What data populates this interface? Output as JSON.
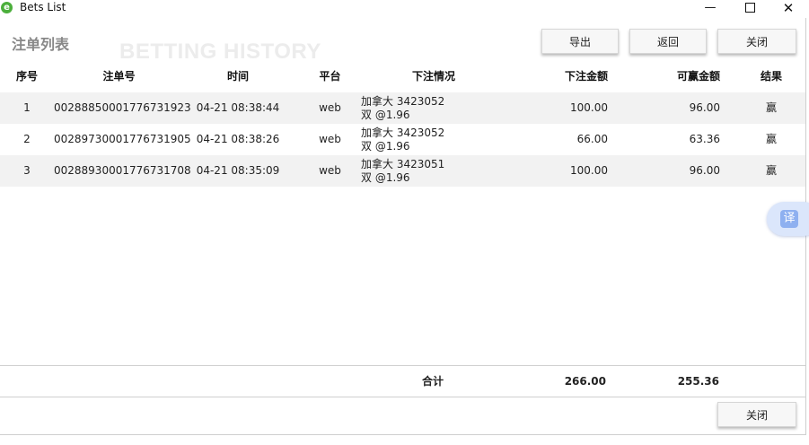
{
  "window": {
    "title": "Bets List",
    "app_icon_glyph": "e",
    "minimize_glyph": "—",
    "close_glyph": "✕"
  },
  "header": {
    "title": "注单列表",
    "watermark": "BETTING HISTORY",
    "export_label": "导出",
    "back_label": "返回",
    "close_label": "关闭"
  },
  "table": {
    "columns": {
      "seq": "序号",
      "bet_id": "注单号",
      "time": "时间",
      "platform": "平台",
      "bet_details": "下注情况",
      "amount": "下注金额",
      "win": "可赢金额",
      "result": "结果"
    },
    "rows": [
      {
        "seq": "1",
        "bet_id": "00288850001776731923",
        "time": "04-21 08:38:44",
        "platform": "web",
        "bet_line1": "加拿大 3423052",
        "bet_line2": "双 @1.96",
        "amount": "100.00",
        "win": "96.00",
        "result": "赢"
      },
      {
        "seq": "2",
        "bet_id": "00289730001776731905",
        "time": "04-21 08:38:26",
        "platform": "web",
        "bet_line1": "加拿大 3423052",
        "bet_line2": "双 @1.96",
        "amount": "66.00",
        "win": "63.36",
        "result": "赢"
      },
      {
        "seq": "3",
        "bet_id": "00288930001776731708",
        "time": "04-21 08:35:09",
        "platform": "web",
        "bet_line1": "加拿大 3423051",
        "bet_line2": "双 @1.96",
        "amount": "100.00",
        "win": "96.00",
        "result": "赢"
      }
    ]
  },
  "summary": {
    "label": "合计",
    "total_amount": "266.00",
    "total_win": "255.36"
  },
  "footer": {
    "close_label": "关闭"
  },
  "translate_widget": {
    "glyph": "译"
  }
}
